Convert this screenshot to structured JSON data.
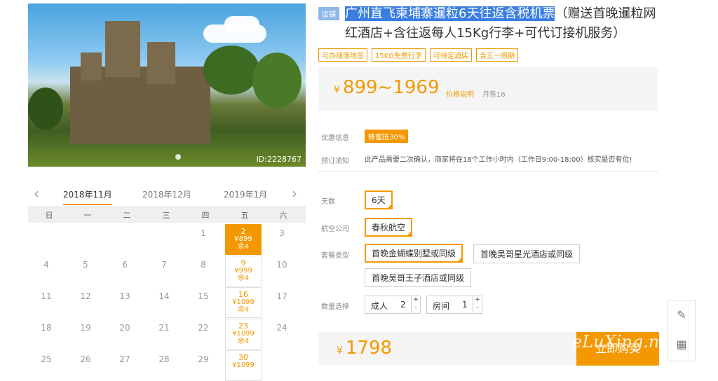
{
  "photo": {
    "id_text": "ID:2228767"
  },
  "calendar": {
    "months": [
      "2018年11月",
      "2018年12月",
      "2019年1月"
    ],
    "weekdays": [
      "日",
      "一",
      "二",
      "三",
      "四",
      "五",
      "六"
    ],
    "rows": [
      [
        "",
        "",
        "",
        "",
        "1",
        "2",
        "3"
      ],
      [
        "4",
        "5",
        "6",
        "7",
        "8",
        "9",
        "10"
      ],
      [
        "11",
        "12",
        "13",
        "14",
        "15",
        "16",
        "17"
      ],
      [
        "18",
        "19",
        "20",
        "21",
        "22",
        "23",
        "24"
      ],
      [
        "25",
        "26",
        "27",
        "28",
        "29",
        "30",
        ""
      ]
    ],
    "avail": [
      {
        "day": "2",
        "price": "¥899",
        "stock": "余4"
      },
      {
        "day": "9",
        "price": "¥999",
        "stock": "余4"
      },
      {
        "day": "16",
        "price": "¥1099",
        "stock": "余4"
      },
      {
        "day": "23",
        "price": "¥1099",
        "stock": "余4"
      },
      {
        "day": "30",
        "price": "¥1099",
        "stock": ""
      }
    ]
  },
  "product": {
    "shop_badge": "店铺",
    "title_highlight": "广州直飞柬埔寨暹粒6天往返含税机票",
    "title_rest": "（赠送首晚暹粒网红酒店+含往返每人15Kg行李+可代订接机服务）",
    "tags": [
      "可办理落地签",
      "15KG免费行李",
      "可待定酒店",
      "含五一假期"
    ],
    "price_symbol": "¥",
    "price_range": "899~1969",
    "price_explain": "价格说明",
    "monthly_sales": "月售16"
  },
  "info": {
    "promo_label": "优惠信息",
    "promo_value": "蜂蜜抵30%",
    "notice_label": "预订须知",
    "notice_value": "此产品需要二次确认，商家将在18个工作小时内（工作日9:00-18:00）核实是否有位!"
  },
  "options": {
    "days_label": "天数",
    "days": "6天",
    "airline_label": "航空公司",
    "airline": "春秋航空",
    "package_label": "套餐类型",
    "packages": [
      "首晚金蝴蝶别墅或同级",
      "首晚吴哥星光酒店或同级",
      "首晚吴哥王子酒店或同级"
    ],
    "qty_label": "数量选择",
    "adults_label": "成人",
    "adults": "2",
    "rooms_label": "房间",
    "rooms": "1"
  },
  "footer": {
    "price_symbol": "¥",
    "total": "1798",
    "buy_label": "立即购买"
  },
  "watermark": "eLuXing.net"
}
